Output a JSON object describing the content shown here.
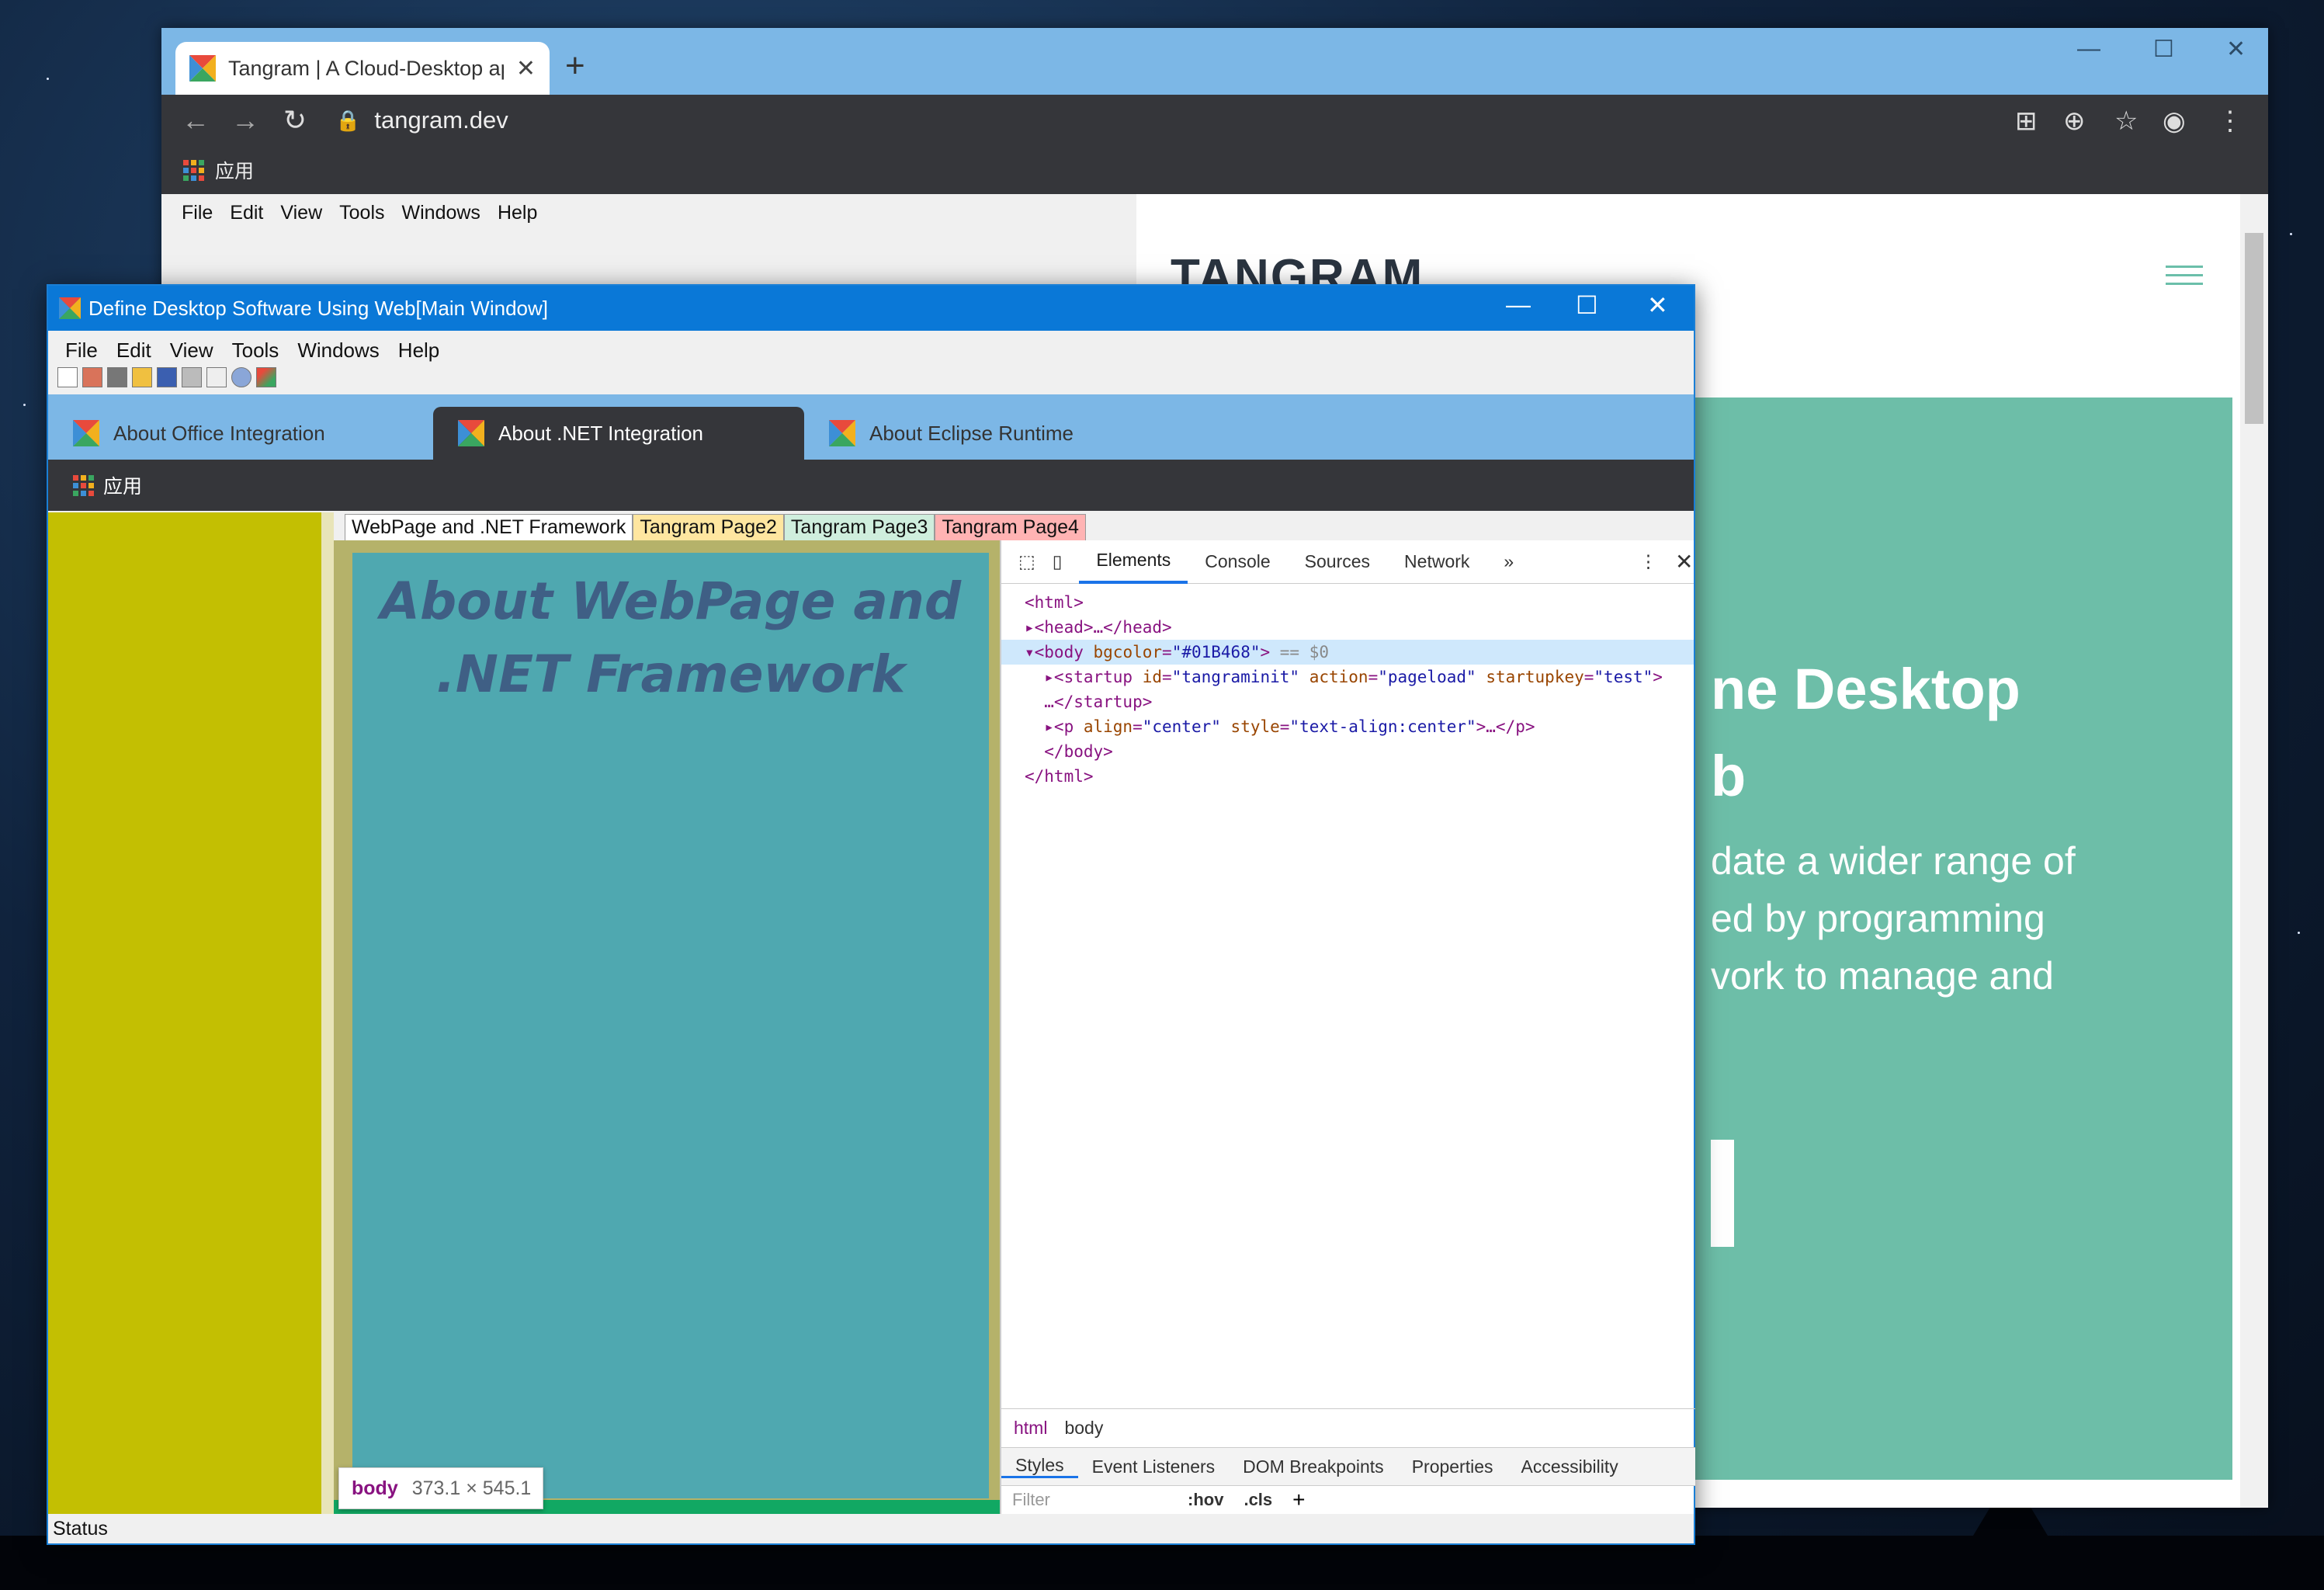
{
  "chrome": {
    "tab_title": "Tangram | A Cloud-Desktop ap",
    "url": "tangram.dev",
    "apps_label": "应用"
  },
  "embedded_menu": [
    "File",
    "Edit",
    "View",
    "Tools",
    "Windows",
    "Help"
  ],
  "site": {
    "logo": "TANGRAM",
    "heading": "ne Desktop\nb",
    "paragraph": "date a wider range of\ned by programming\nvork to manage and"
  },
  "main_window": {
    "title": "Define Desktop Software Using Web[Main Window]",
    "menu": [
      "File",
      "Edit",
      "View",
      "Tools",
      "Windows",
      "Help"
    ],
    "tabs": [
      "About Office Integration",
      "About .NET Integration",
      "About Eclipse Runtime"
    ],
    "apps_label": "应用",
    "page_tabs": [
      {
        "label": "WebPage and .NET Framework",
        "color": "#ffffff"
      },
      {
        "label": "Tangram Page2",
        "color": "#ffe6a0"
      },
      {
        "label": "Tangram Page3",
        "color": "#cfeedd"
      },
      {
        "label": "Tangram Page4",
        "color": "#ffb3b3"
      }
    ],
    "heading": "About WebPage and .NET Framework",
    "tooltip_tag": "body",
    "tooltip_size": "373.1 × 545.1",
    "status": "Status"
  },
  "devtools": {
    "tabs": [
      "Elements",
      "Console",
      "Sources",
      "Network"
    ],
    "breadcrumb": [
      "html",
      "body"
    ],
    "styles_tabs": [
      "Styles",
      "Event Listeners",
      "DOM Breakpoints",
      "Properties",
      "Accessibility"
    ],
    "filter_placeholder": "Filter",
    "hov": ":hov",
    "cls": ".cls"
  }
}
